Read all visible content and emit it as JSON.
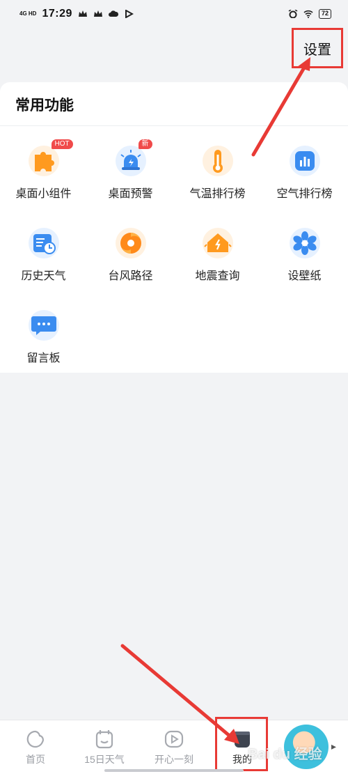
{
  "status_bar": {
    "network": "4G HD",
    "time": "17:29",
    "battery": "72"
  },
  "header": {
    "settings_label": "设置"
  },
  "common_functions": {
    "title": "常用功能",
    "items": [
      {
        "label": "桌面小组件",
        "icon": "puzzle-icon",
        "badge": "HOT"
      },
      {
        "label": "桌面预警",
        "icon": "alarm-light-icon",
        "badge": "新"
      },
      {
        "label": "气温排行榜",
        "icon": "thermometer-icon"
      },
      {
        "label": "空气排行榜",
        "icon": "bar-chart-icon"
      },
      {
        "label": "历史天气",
        "icon": "calendar-clock-icon"
      },
      {
        "label": "台风路径",
        "icon": "typhoon-icon"
      },
      {
        "label": "地震查询",
        "icon": "earthquake-house-icon"
      },
      {
        "label": "设壁纸",
        "icon": "flower-icon"
      },
      {
        "label": "留言板",
        "icon": "message-board-icon"
      }
    ]
  },
  "tab_bar": {
    "tabs": [
      {
        "label": "首页",
        "icon": "home-icon"
      },
      {
        "label": "15日天气",
        "icon": "calendar-icon"
      },
      {
        "label": "开心一刻",
        "icon": "play-icon"
      },
      {
        "label": "我的",
        "icon": "profile-icon",
        "active": true
      }
    ]
  },
  "watermark": "Bai du 经验",
  "colors": {
    "accent_annotation": "#e83a35",
    "badge_red": "#f04a4a",
    "icon_orange": "#ff9a1f",
    "icon_blue": "#3a8cf0"
  }
}
